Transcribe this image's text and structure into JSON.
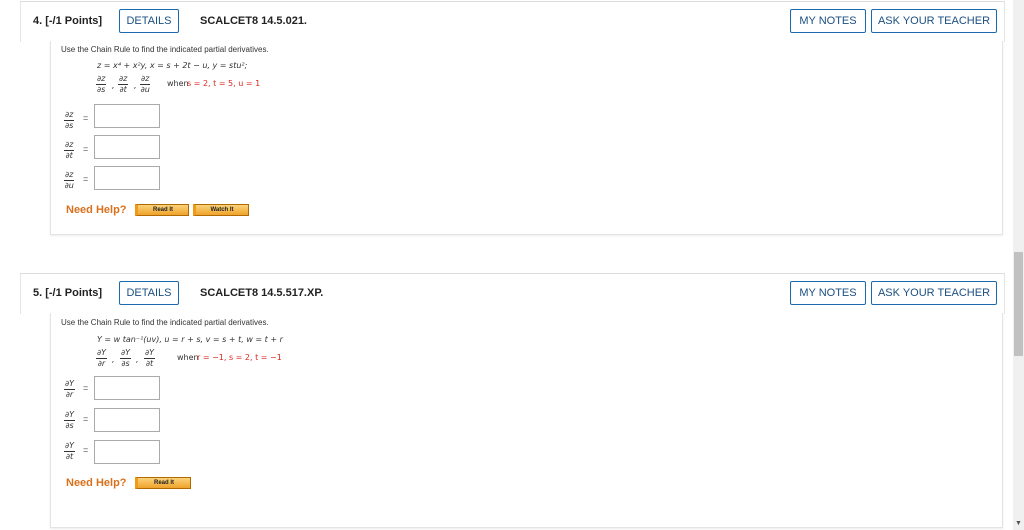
{
  "q4": {
    "number": "4.  [-/1 Points]",
    "details": "DETAILS",
    "code": "SCALCET8 14.5.021.",
    "my_notes": "MY NOTES",
    "ask": "ASK YOUR TEACHER",
    "instruction": "Use the Chain Rule to find the indicated partial derivatives.",
    "eq1": "z = x⁴ + x²y,   x = s + 2t − u,   y = stu²;",
    "when_prefix": "when",
    "when_values": "s = 2, t = 5, u = 1",
    "d_num": "∂z",
    "d1_den": "∂s",
    "d2_den": "∂t",
    "d3_den": "∂u",
    "need_help": "Need Help?",
    "read_it": "Read It",
    "watch_it": "Watch It"
  },
  "q5": {
    "number": "5.  [-/1 Points]",
    "details": "DETAILS",
    "code": "SCALCET8 14.5.517.XP.",
    "my_notes": "MY NOTES",
    "ask": "ASK YOUR TEACHER",
    "instruction": "Use the Chain Rule to find the indicated partial derivatives.",
    "eq1": "Y = w tan⁻¹(uv),    u = r + s,    v = s + t,    w = t + r",
    "when_prefix": "when",
    "when_values": "r = −1,   s = 2,   t = −1",
    "d_num": "∂Y",
    "d1_den": "∂r",
    "d2_den": "∂s",
    "d3_den": "∂t",
    "need_help": "Need Help?",
    "read_it": "Read It"
  },
  "comma": ",",
  "equals": "="
}
